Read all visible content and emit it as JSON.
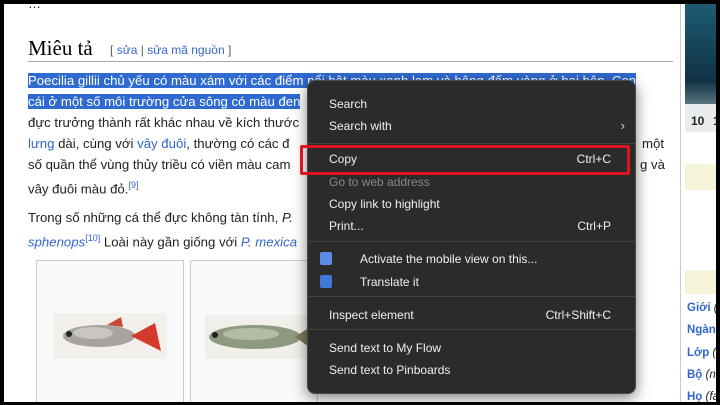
{
  "article": {
    "top_fragment": "…",
    "heading": "Miêu tả",
    "edit_open": "[",
    "edit_link": "sửa",
    "edit_sep": " | ",
    "edit_source_link": "sửa mã nguồn",
    "edit_close": "]",
    "line1_selected": "Poecilia gillii chủ yếu có màu xám với các điểm nổi bật màu xanh lam và hông đốm vàng ở hai bên. Con",
    "line2_selected": "cái ở một số môi trường cửa sông có màu đen",
    "line3": "đực trưởng thành rất khác nhau về kích thước",
    "line4_link1": "lưng",
    "line4_text1": " dài, cùng với ",
    "line4_link2": "vây đuôi",
    "line4_text2": ", thường có các đ",
    "line5": "số quần thể vùng thủy triều có viền màu cam",
    "line6_text": "vây đuôi màu đỏ.",
    "line6_ref": "[9]",
    "right_tail_1": "một",
    "right_tail_2": "g và",
    "para2_line1_text": "Trong số những cá thể đực không tàn tính, ",
    "para2_line1_italic": "P.",
    "para2_line2_link": "sphenops",
    "para2_line2_ref": "[10]",
    "para2_line2_text": " Loài này gần giống với ",
    "para2_line2_redlink": "P. mexica"
  },
  "sidebar": {
    "ruler_left": "10",
    "ruler_right": "1",
    "rows": [
      {
        "label": "Giới",
        "extra": " ("
      },
      {
        "label": "Ngành",
        "extra": ""
      },
      {
        "label": "Lớp",
        "extra": " ("
      },
      {
        "label": "Bộ",
        "extra": " (no"
      },
      {
        "label": "Họ",
        "extra": " (fa"
      }
    ]
  },
  "context_menu": {
    "search": "Search",
    "search_with": "Search with",
    "copy": "Copy",
    "copy_shortcut": "Ctrl+C",
    "go_to_web_address": "Go to web address",
    "copy_link_to_highlight": "Copy link to highlight",
    "print": "Print...",
    "print_shortcut": "Ctrl+P",
    "activate_mobile_view": "Activate the mobile view on this...",
    "translate_it": "Translate it",
    "inspect_element": "Inspect element",
    "inspect_shortcut": "Ctrl+Shift+C",
    "send_my_flow": "Send text to My Flow",
    "send_pinboards": "Send text to Pinboards"
  },
  "colors": {
    "selection": "#2f6ad0",
    "menu_bg": "#2b2b2b",
    "highlight_border": "#e0141e",
    "link": "#3366cc"
  },
  "icons": {
    "submenu": "chevron-right-icon",
    "mobile_view": "mobile-view-extension-icon",
    "translate": "translate-extension-icon"
  }
}
